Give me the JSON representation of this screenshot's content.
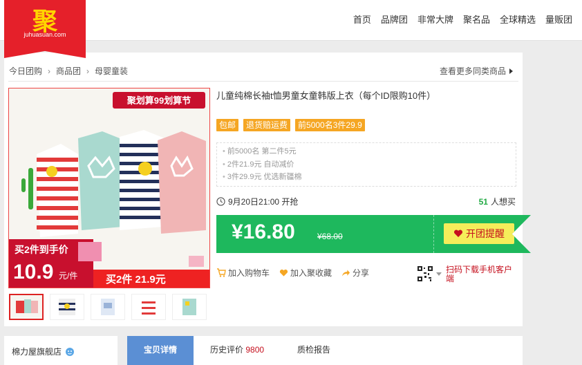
{
  "logo": {
    "char": "聚",
    "domain": "juhuasuan.com"
  },
  "nav": [
    "首页",
    "品牌团",
    "非常大牌",
    "聚名品",
    "全球精选",
    "量贩团"
  ],
  "breadcrumb": [
    "今日团购",
    "商品团",
    "母婴童装"
  ],
  "see_more": "查看更多同类商品",
  "gallery": {
    "banner_text": "聚划算99划算节",
    "promo_line1": "买2件到手价",
    "promo_price": "10.9",
    "promo_unit": "元/件",
    "bottom_text": "买2件 21.9元"
  },
  "product": {
    "title": "儿童纯棉长袖t恤男童女童韩版上衣（每个ID限购10件）",
    "badges": [
      "包邮",
      "退货赔运费",
      "前5000名3件29.9"
    ],
    "promos": [
      "前5000名 第二件5元",
      "2件21.9元 自动减价",
      "3件29.9元 优选新疆棉"
    ],
    "start_time": "9月20日21:00 开抢",
    "want_count": "51",
    "want_label": "人想买",
    "price": "¥16.80",
    "original_price": "¥68.00",
    "remind_label": "开团提醒"
  },
  "actions": {
    "add_cart": "加入购物车",
    "favorite": "加入聚收藏",
    "share": "分享"
  },
  "qr_text": "扫码下载手机客户端",
  "shop_name": "棉力屋旗舰店",
  "tabs": {
    "details": "宝贝详情",
    "reviews_label": "历史评价",
    "reviews_count": "9800",
    "inspection": "质检报告"
  },
  "colors": {
    "brand_red": "#e5202a",
    "price_green": "#1eb85d",
    "badge_orange": "#f5a623",
    "tab_blue": "#5b8fd4"
  }
}
